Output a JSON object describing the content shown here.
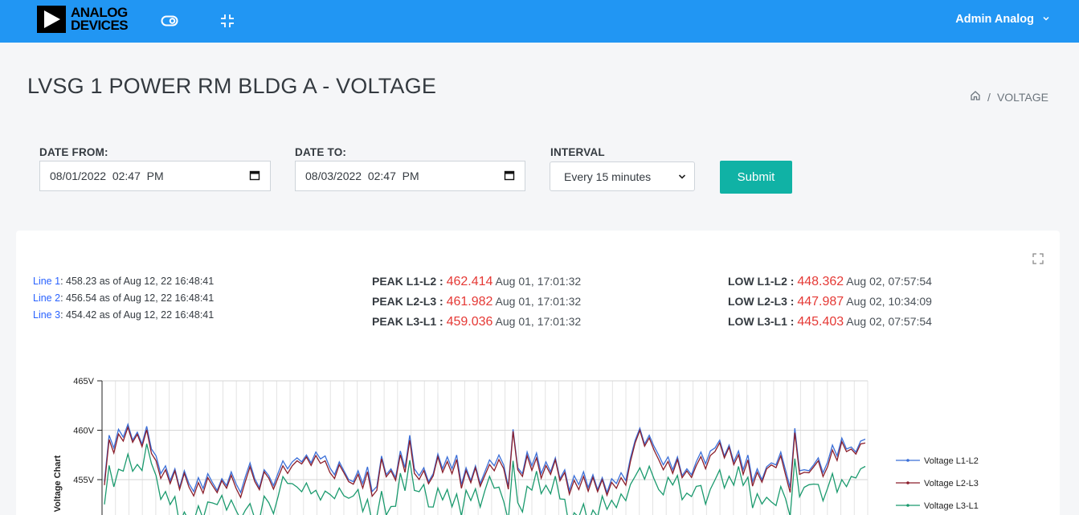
{
  "header": {
    "logo_line1": "ANALOG",
    "logo_line2": "DEVICES",
    "user_name": "Admin Analog",
    "icons": [
      "toggle-icon",
      "compress-icon",
      "chevron-down-icon"
    ],
    "color": "#2196f3"
  },
  "page": {
    "title": "LVSG 1 POWER RM BLDG A - VOLTAGE",
    "breadcrumb_current": "VOLTAGE"
  },
  "filters": {
    "date_from_label": "DATE FROM:",
    "date_from_value": "08/01/2022  02:47  PM",
    "date_to_label": "DATE TO:",
    "date_to_value": "08/03/2022  02:47  PM",
    "interval_label": "INTERVAL",
    "interval_value": "Every 15 minutes",
    "submit_label": "Submit"
  },
  "readings": {
    "lines": [
      {
        "label": "Line 1",
        "text": ": 458.23 as of Aug 12, 22 16:48:41"
      },
      {
        "label": "Line 2",
        "text": ": 456.54 as of Aug 12, 22 16:48:41"
      },
      {
        "label": "Line 3",
        "text": ": 454.42 as of Aug 12, 22 16:48:41"
      }
    ],
    "peaks": [
      {
        "key": "PEAK L1-L2 :",
        "value": "462.414",
        "time": "Aug 01, 17:01:32"
      },
      {
        "key": "PEAK L2-L3 :",
        "value": "461.982",
        "time": "Aug 01, 17:01:32"
      },
      {
        "key": "PEAK L3-L1 :",
        "value": "459.036",
        "time": "Aug 01, 17:01:32"
      }
    ],
    "lows": [
      {
        "key": "LOW L1-L2 :",
        "value": "448.362",
        "time": "Aug 02, 07:57:54"
      },
      {
        "key": "LOW L2-L3 :",
        "value": "447.987",
        "time": "Aug 02, 10:34:09"
      },
      {
        "key": "LOW L3-L1 :",
        "value": "445.403",
        "time": "Aug 02, 07:57:54"
      }
    ],
    "value_color": "#e53935"
  },
  "chart_data": {
    "type": "line",
    "ylabel": "Voltage Chart",
    "yticks": [
      "465V",
      "460V",
      "455V"
    ],
    "ylim_visible": [
      453,
      465
    ],
    "series": [
      {
        "name": "Voltage L1-L2",
        "color": "#3b6fd8",
        "values": [
          454.8,
          459.5,
          458.2,
          460.1,
          459.3,
          460.6,
          459.0,
          459.8,
          458.6,
          460.4,
          458.1,
          457.4,
          455.6,
          456.4,
          454.9,
          456.1,
          454.2,
          455.9,
          454.6,
          453.8,
          455.2,
          454.1,
          455.6,
          454.7,
          453.9,
          455.1,
          454.4,
          455.8,
          454.6,
          453.7,
          455.3,
          456.7,
          455.1,
          454.2,
          456.0,
          455.4,
          454.4,
          455.7,
          456.9,
          456.1,
          456.8,
          457.2,
          456.8,
          457.5,
          456.7,
          457.8,
          457.1,
          457.4,
          456.2,
          455.5,
          456.8,
          455.9,
          455.0,
          454.8,
          455.9,
          454.6,
          456.3,
          453.8,
          454.3,
          457.4,
          455.5,
          456.1,
          455.2,
          457.9,
          456.2,
          459.5,
          456.1,
          455.4,
          456.2,
          454.8,
          455.6,
          457.6,
          456.1,
          457.3,
          456.1,
          457.5,
          454.5,
          456.2,
          454.9,
          456.4,
          454.6,
          455.8,
          457.0,
          456.4,
          457.5,
          456.5,
          454.3,
          460.1,
          456.2,
          455.6,
          457.8,
          456.4,
          457.7,
          455.6,
          456.8,
          455.8,
          457.2,
          455.1,
          456.0,
          453.9,
          455.4,
          454.5,
          455.8,
          454.2,
          455.5,
          454.0,
          455.2,
          453.7,
          455.1,
          454.6,
          455.7,
          454.9,
          457.2,
          459.0,
          460.2,
          458.6,
          459.5,
          458.4,
          457.5,
          456.5,
          457.3,
          456.0,
          457.3,
          455.4,
          456.1,
          455.5,
          456.8,
          457.8,
          456.6,
          457.9,
          458.2,
          459.0,
          457.4,
          458.5,
          456.8,
          457.9,
          456.0,
          457.5,
          454.8,
          456.1,
          455.0,
          456.3,
          456.7,
          456.5,
          457.8,
          456.0,
          454.2,
          460.2,
          455.9,
          456.0,
          455.9,
          456.5,
          457.2,
          455.7,
          456.8,
          458.5,
          457.4,
          459.2,
          458.1,
          458.3,
          457.8,
          458.9,
          459.1
        ],
        "line_ends": "458.23"
      },
      {
        "name": "Voltage L2-L3",
        "color": "#8b1e2b"
      },
      {
        "name": "Voltage L3-L1",
        "color": "#1b9a6e"
      }
    ],
    "legend": "right",
    "grid": true
  }
}
